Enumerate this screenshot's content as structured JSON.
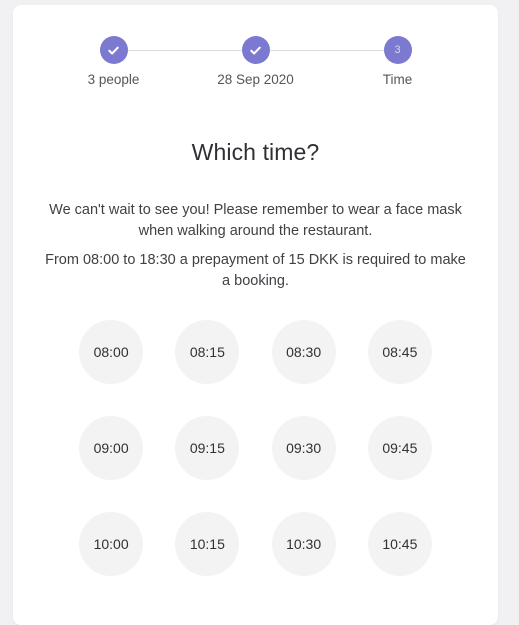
{
  "theme": {
    "page_background": "#f1f1f3",
    "card_background": "#ffffff",
    "accent": "#7b7ad0",
    "slot_background": "#f3f3f3",
    "connector": "#d9d9e0",
    "text_primary": "#2e3033",
    "text_secondary": "#55565c"
  },
  "stepper": {
    "steps": [
      {
        "id": "people",
        "label": "3 people",
        "state": "completed",
        "icon": "check-icon",
        "number": "1"
      },
      {
        "id": "date",
        "label": "28 Sep 2020",
        "state": "completed",
        "icon": "check-icon",
        "number": "2"
      },
      {
        "id": "time",
        "label": "Time",
        "state": "current",
        "icon": "",
        "number": "3"
      }
    ]
  },
  "main": {
    "title": "Which time?",
    "messages": [
      "We can't wait to see you! Please remember to wear a face mask when walking around the restaurant.",
      "From 08:00 to 18:30 a prepayment of 15 DKK is required to make a booking."
    ]
  },
  "time_slots": [
    {
      "time": "08:00"
    },
    {
      "time": "08:15"
    },
    {
      "time": "08:30"
    },
    {
      "time": "08:45"
    },
    {
      "time": "09:00"
    },
    {
      "time": "09:15"
    },
    {
      "time": "09:30"
    },
    {
      "time": "09:45"
    },
    {
      "time": "10:00"
    },
    {
      "time": "10:15"
    },
    {
      "time": "10:30"
    },
    {
      "time": "10:45"
    }
  ]
}
